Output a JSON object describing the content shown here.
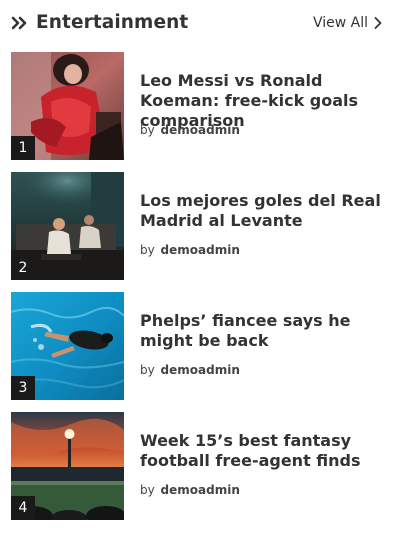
{
  "widget": {
    "title": "Entertainment",
    "view_all_label": "View All"
  },
  "posts": [
    {
      "number": "1",
      "title": "Leo Messi vs Ronald Koeman: free-kick goals comparison",
      "by_label": "by",
      "author": "demoadmin"
    },
    {
      "number": "2",
      "title": "Los mejores goles del Real Madrid al Levante",
      "by_label": "by",
      "author": "demoadmin"
    },
    {
      "number": "3",
      "title": "Phelps’ fiancee says he might be back",
      "by_label": "by",
      "author": "demoadmin"
    },
    {
      "number": "4",
      "title": "Week 15’s best fantasy football free-agent finds",
      "by_label": "by",
      "author": "demoadmin"
    }
  ],
  "colors": {
    "text": "#333333",
    "number_badge_bg": "#1a1a1a",
    "number_badge_text": "#ffffff"
  },
  "icons": {
    "header": "double-chevron-right-icon",
    "view_all": "chevron-right-icon"
  }
}
